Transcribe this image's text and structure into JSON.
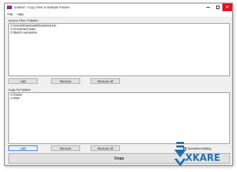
{
  "window": {
    "title": "Untitled - Copy Files to Multiple Folders"
  },
  "menu": {
    "items": [
      "File",
      "Help"
    ]
  },
  "source": {
    "label": "Source Files / Folders",
    "items": [
      "C:\\Users\\Downloads\\Download.doc",
      "C:\\Converted Video",
      "C:\\Batch Automation"
    ],
    "buttons": {
      "add": "Add",
      "remove": "Remove",
      "remove_all": "Remove All"
    }
  },
  "destination": {
    "label": "Copy To Folders",
    "items": [
      "C:\\Folder",
      "C:\\PDF"
    ],
    "buttons": {
      "add": "Add",
      "remove": "Remove",
      "remove_all": "Remove All"
    },
    "overwrite_label": "Overwrite Existing",
    "overwrite_checked": false
  },
  "actions": {
    "copy_label": "Copy"
  },
  "colors": {
    "accent": "#1f6fb5",
    "close_button": "#e81123"
  },
  "logo": {
    "text": "XKARE"
  }
}
